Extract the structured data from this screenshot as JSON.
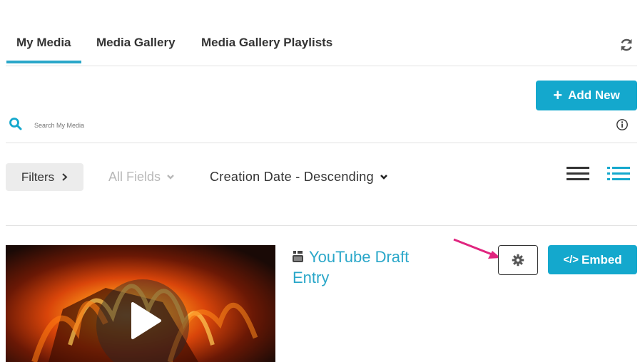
{
  "tabs": [
    {
      "label": "My Media",
      "active": true
    },
    {
      "label": "Media Gallery",
      "active": false
    },
    {
      "label": "Media Gallery Playlists",
      "active": false
    }
  ],
  "toolbar": {
    "add_new_label": "Add New"
  },
  "search": {
    "placeholder": "Search My Media"
  },
  "filters": {
    "filters_label": "Filters",
    "fields_value": "All Fields",
    "sort_value": "Creation Date - Descending"
  },
  "entry": {
    "title_line1": "YouTube Draft",
    "title_line2": "Entry",
    "embed_label": "Embed"
  },
  "colors": {
    "accent": "#14a8cd",
    "annotation_arrow": "#e0257f"
  }
}
